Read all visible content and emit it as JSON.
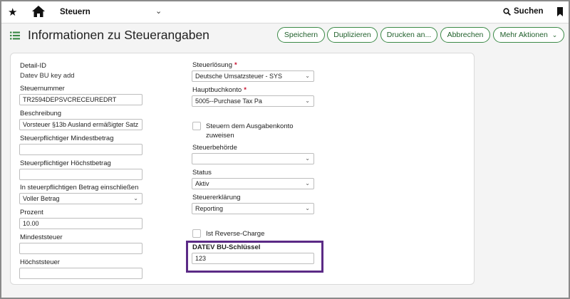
{
  "topbar": {
    "nav_label": "Steuern",
    "search_label": "Suchen"
  },
  "header": {
    "title": "Informationen zu Steuerangaben",
    "buttons": {
      "save": "Speichern",
      "duplicate": "Duplizieren",
      "print": "Drucken an...",
      "cancel": "Abbrechen",
      "more": "Mehr Aktionen"
    }
  },
  "form": {
    "left": {
      "detail_id": {
        "label": "Detail-ID",
        "value": "Datev BU key add"
      },
      "tax_number": {
        "label": "Steuernummer",
        "value": "TR2594DEPSVCRECEUREDRT"
      },
      "description": {
        "label": "Beschreibung",
        "value": "Vorsteuer §13b Ausland ermäßigter Satz"
      },
      "min_amount": {
        "label": "Steuerpflichtiger Mindestbetrag",
        "value": ""
      },
      "max_amount": {
        "label": "Steuerpflichtiger Höchstbetrag",
        "value": ""
      },
      "include_in_amount": {
        "label": "In steuerpflichtigen Betrag einschließen",
        "value": "Voller Betrag"
      },
      "percent": {
        "label": "Prozent",
        "value": "10.00"
      },
      "min_tax": {
        "label": "Mindeststeuer",
        "value": ""
      },
      "max_tax": {
        "label": "Höchststeuer",
        "value": ""
      }
    },
    "right": {
      "tax_solution": {
        "label": "Steuerlösung",
        "value": "Deutsche Umsatzsteuer - SYS",
        "required_mark": "*"
      },
      "gl_account": {
        "label": "Hauptbuchkonto",
        "value": "5005--Purchase Tax Pa",
        "required_mark": "*"
      },
      "expense_checkbox": {
        "label_line1": "Steuern dem Ausgabenkonto",
        "label_line2": "zuweisen",
        "checked": false
      },
      "tax_authority": {
        "label": "Steuerbehörde",
        "value": ""
      },
      "status": {
        "label": "Status",
        "value": "Aktiv"
      },
      "tax_return": {
        "label": "Steuererklärung",
        "value": "Reporting"
      },
      "reverse_charge": {
        "label": "Ist Reverse-Charge",
        "checked": false
      },
      "datev_key": {
        "label": "DATEV BU-Schlüssel",
        "value": "123"
      }
    }
  },
  "colors": {
    "accent_green": "#3b8a47",
    "highlight_purple": "#5b2a86",
    "required_red": "#c8102e"
  }
}
